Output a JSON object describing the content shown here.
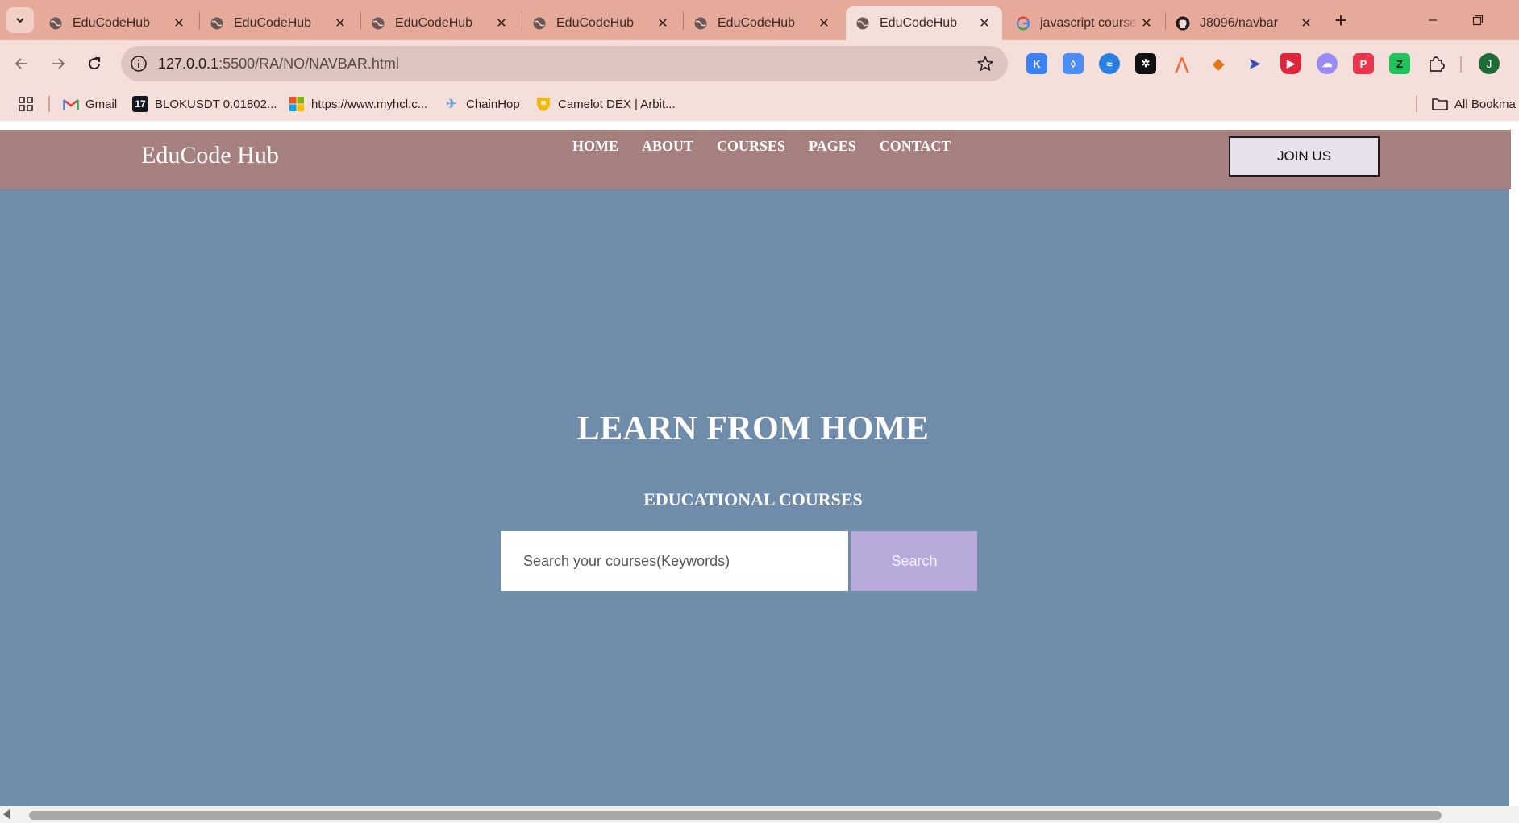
{
  "browser": {
    "tabs": [
      {
        "title": "EduCodeHub",
        "favicon": "globe-icon",
        "active": false
      },
      {
        "title": "EduCodeHub",
        "favicon": "globe-icon",
        "active": false
      },
      {
        "title": "EduCodeHub",
        "favicon": "globe-icon",
        "active": false
      },
      {
        "title": "EduCodeHub",
        "favicon": "globe-icon",
        "active": false
      },
      {
        "title": "EduCodeHub",
        "favicon": "globe-icon",
        "active": false
      },
      {
        "title": "EduCodeHub",
        "favicon": "globe-icon",
        "active": true
      },
      {
        "title": "javascript course",
        "favicon": "google-icon",
        "active": false
      },
      {
        "title": "J8096/navbar",
        "favicon": "github-icon",
        "active": false
      }
    ],
    "url_host": "127.0.0.1",
    "url_path": ":5500/RA/NO/NAVBAR.html",
    "avatar_letter": "J",
    "bookmarks": [
      {
        "label": "Gmail",
        "icon": "gmail-icon"
      },
      {
        "label": "BLOKUSDT 0.01802...",
        "icon": "tradingview-icon"
      },
      {
        "label": "https://www.myhcl.c...",
        "icon": "microsoft-icon"
      },
      {
        "label": "ChainHop",
        "icon": "chainhop-icon"
      },
      {
        "label": "Camelot DEX | Arbit...",
        "icon": "camelot-icon"
      }
    ],
    "all_bookmarks_label": "All Bookma",
    "colors": {
      "tabstrip": "#e6aa9b",
      "toolbar": "#f5dfda",
      "omnibox": "#dfc5bf"
    }
  },
  "site": {
    "brand": "EduCode Hub",
    "menu": [
      "HOME",
      "ABOUT",
      "COURSES",
      "PAGES",
      "CONTACT"
    ],
    "join_label": "JOIN US",
    "hero_title": "LEARN FROM HOME",
    "hero_subtitle": "EDUCATIONAL COURSES",
    "search_placeholder": "Search your courses(Keywords)",
    "search_button": "Search",
    "colors": {
      "navbar": "#a67f7f",
      "hero": "#6f8cab",
      "search_button": "#b7aadb",
      "join_button": "#e6e1ea"
    }
  }
}
